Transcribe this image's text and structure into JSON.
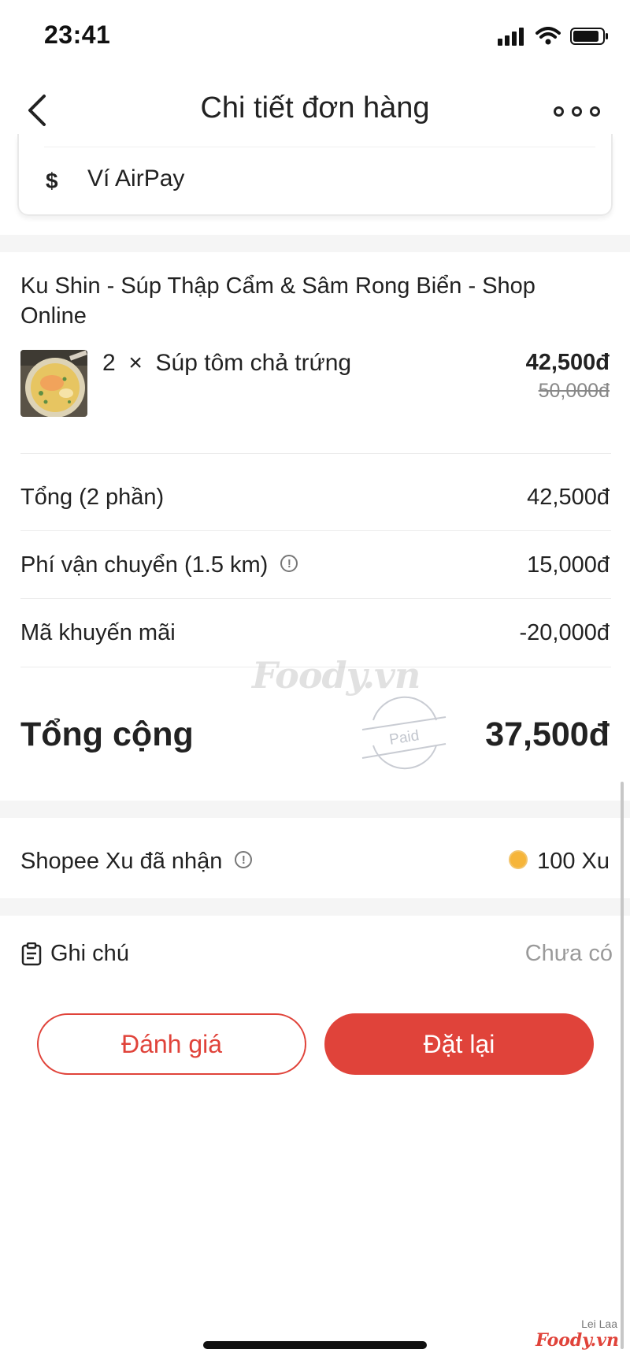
{
  "status_bar": {
    "time": "23:41"
  },
  "nav": {
    "title": "Chi tiết đơn hàng"
  },
  "payment": {
    "currency_symbol": "$",
    "method": "Ví AirPay"
  },
  "shop": {
    "name": "Ku Shin - Súp Thập Cẩm & Sâm Rong Biển - Shop Online"
  },
  "item": {
    "quantity_label": "2  ×  Súp tôm chả trứng",
    "price": "42,500đ",
    "original_price": "50,000đ"
  },
  "summary": {
    "subtotal_label": "Tổng (2 phần)",
    "subtotal_value": "42,500đ",
    "shipping_label": "Phí vận chuyển (1.5 km)",
    "shipping_value": "15,000đ",
    "promo_label": "Mã khuyến mãi",
    "promo_value": "-20,000đ",
    "total_label": "Tổng cộng",
    "total_value": "37,500đ"
  },
  "watermark": {
    "logo": "Foody.vn",
    "stamp": "Paid",
    "author": "Lei Laa",
    "brand": "Foody.vn"
  },
  "coins": {
    "label": "Shopee Xu đã nhận",
    "value": "100 Xu"
  },
  "note": {
    "label": "Ghi chú",
    "value": "Chưa có"
  },
  "actions": {
    "rate_label": "Đánh giá",
    "reorder_label": "Đặt lại"
  },
  "colors": {
    "accent": "#e0433a",
    "coin": "#f6b53a",
    "muted": "#9a9a9a",
    "section_gap": "#f5f5f5"
  }
}
